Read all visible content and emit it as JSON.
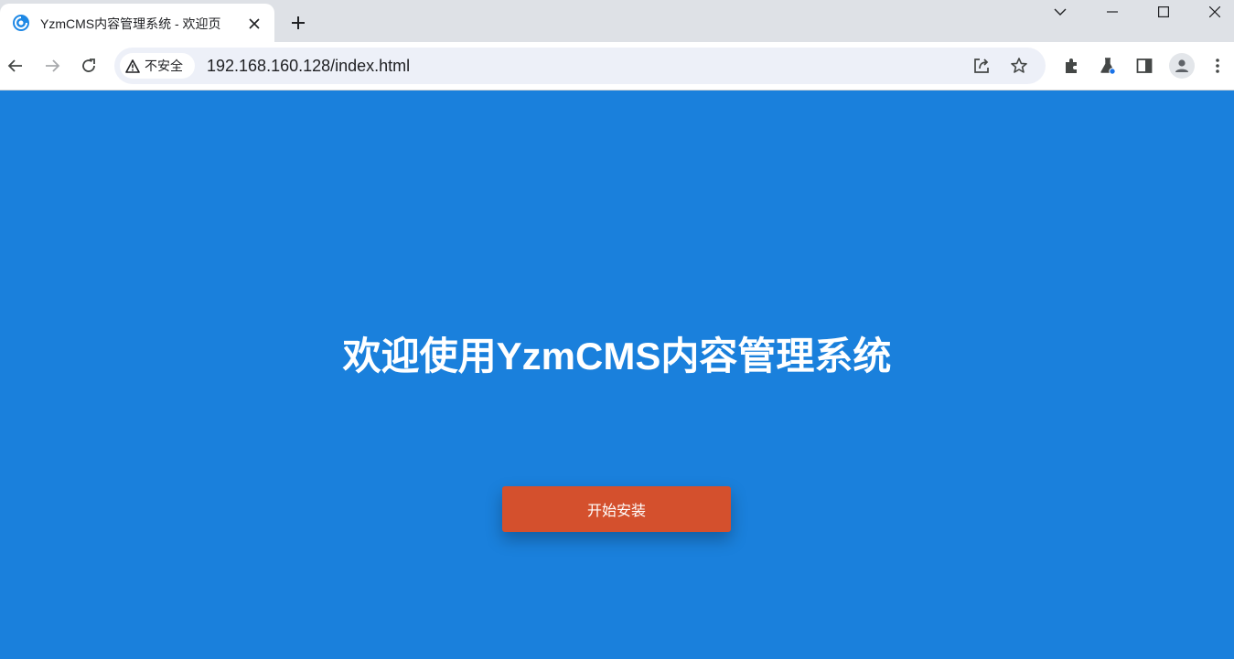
{
  "browser": {
    "tab": {
      "title": "YzmCMS内容管理系统 - 欢迎页",
      "favicon": "yzmcms-logo-icon"
    },
    "address_bar": {
      "security_label": "不安全",
      "url": "192.168.160.128/index.html"
    }
  },
  "page": {
    "title": "欢迎使用YzmCMS内容管理系统",
    "install_button_label": "开始安装",
    "background_color": "#1a80dc",
    "button_color": "#d4502d"
  }
}
